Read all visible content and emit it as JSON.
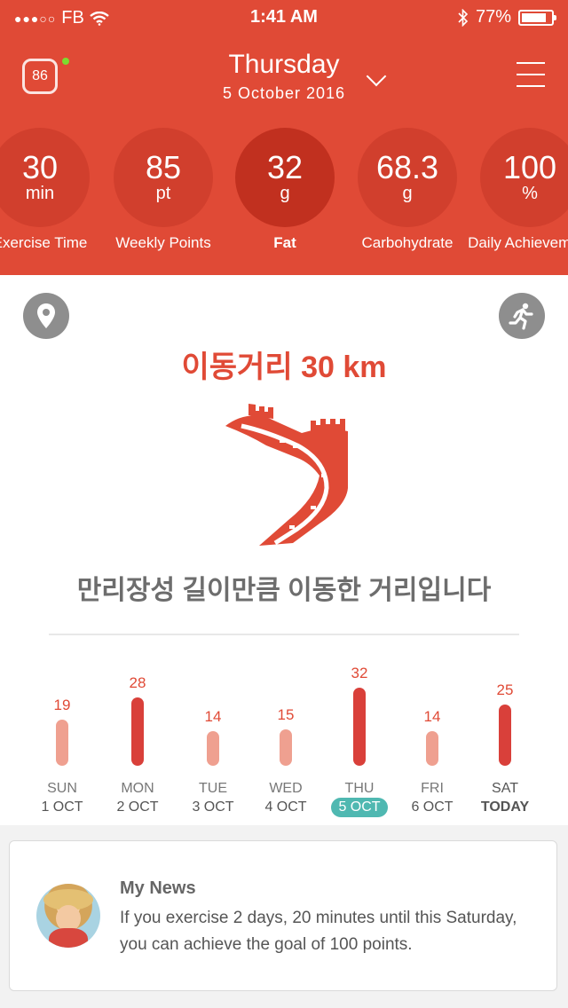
{
  "status_bar": {
    "carrier": "FB",
    "time": "1:41 AM",
    "battery": "77%",
    "battery_level": 0.77
  },
  "header": {
    "score": "86",
    "day": "Thursday",
    "date": "5 October 2016",
    "stats": [
      {
        "value": "30",
        "unit": "min",
        "label": "Exercise Time"
      },
      {
        "value": "85",
        "unit": "pt",
        "label": "Weekly Points"
      },
      {
        "value": "32",
        "unit": "g",
        "label": "Fat"
      },
      {
        "value": "68.3",
        "unit": "g",
        "label": "Carbohydrate"
      },
      {
        "value": "100",
        "unit": "%",
        "label": "Daily Achievement"
      }
    ]
  },
  "main": {
    "title": "이동거리 30 km",
    "subtitle": "만리장성 길이만큼 이동한 거리입니다"
  },
  "weekly": {
    "days": [
      {
        "value": 19,
        "day": "SUN",
        "date": "1 OCT"
      },
      {
        "value": 28,
        "day": "MON",
        "date": "2 OCT"
      },
      {
        "value": 14,
        "day": "TUE",
        "date": "3 OCT"
      },
      {
        "value": 15,
        "day": "WED",
        "date": "4 OCT"
      },
      {
        "value": 32,
        "day": "THU",
        "date": "5 OCT"
      },
      {
        "value": 14,
        "day": "FRI",
        "date": "6 OCT"
      },
      {
        "value": 25,
        "day": "SAT",
        "date": "TODAY"
      }
    ],
    "selected_index": 4,
    "highlight_color": "#4fb8b1"
  },
  "news": {
    "heading": "My News",
    "text": "If you exercise 2 days, 20 minutes until this Saturday, you can achieve the goal of 100 points."
  },
  "colors": {
    "brand": "#e04a36",
    "bar_dark": "#d9403a",
    "bar_light": "#efa090"
  }
}
